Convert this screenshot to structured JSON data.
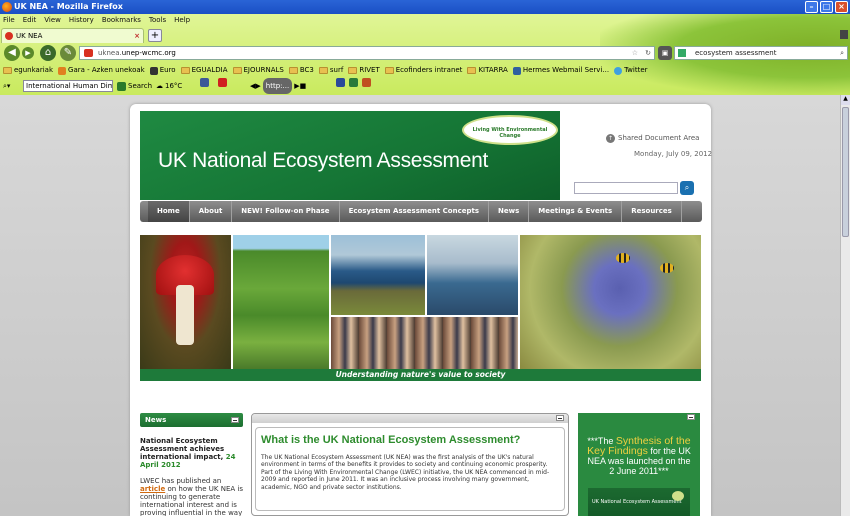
{
  "browser": {
    "window_title": "UK NEA - Mozilla Firefox",
    "menu": [
      "File",
      "Edit",
      "View",
      "History",
      "Bookmarks",
      "Tools",
      "Help"
    ],
    "tab_label": "UK NEA",
    "new_tab": "+",
    "url_prefix": "uknea.",
    "url_domain": "unep-wcmc.org",
    "search_query": "ecosystem assessment",
    "bookmarks": [
      "egunkariak",
      "Gara - Azken unekoak",
      "Euro",
      "EGUALDIA",
      "EJOURNALS",
      "BC3",
      "surf",
      "RIVET",
      "Ecofinders intranet",
      "KITARRA",
      "Hermes Webmail Servi...",
      "Twitter"
    ],
    "toolbar2": {
      "search_input": "International Human Dimensions",
      "search_label": "Search",
      "weather": "16°C",
      "radio_label": "http:..."
    }
  },
  "site": {
    "header_title": "UK National Ecosystem Assessment",
    "lwec_logo_text": "Living With Environmental Change",
    "shared_area": "Shared Document Area",
    "date": "Monday, July 09, 2012",
    "search_button": "⌕",
    "nav": [
      "Home",
      "About",
      "NEW! Follow-on Phase",
      "Ecosystem Assessment Concepts",
      "News",
      "Meetings & Events",
      "Resources"
    ],
    "hero_caption": "Understanding nature's value to society",
    "news": {
      "header": "News",
      "headline": "National Ecosystem Assessment achieves international impact,",
      "headline_date": "24 April 2012",
      "body_before": "LWEC has published an",
      "body_link": "article",
      "body_after": "on how the UK NEA is continuing to generate international interest and is proving influential in the way other nations approach their"
    },
    "main": {
      "title": "What is the UK National Ecosystem Assessment?",
      "text": "The UK National Ecosystem Assessment (UK NEA) was the first analysis of the UK's natural environment in terms of the benefits it provides to society and continuing economic prosperity. Part of the Living With Environmental Change (LWEC) initiative, the UK NEA commenced in mid-2009 and reported in June 2011. It was an inclusive process involving many government, academic, NGO and private sector institutions."
    },
    "synthesis": {
      "prefix": "***The",
      "highlight": "Synthesis of the Key Findings",
      "suffix": "for the UK NEA was launched on the 2 June 2011***",
      "book_label": "UK National Ecosystem Assessment"
    }
  },
  "colors": {
    "brand_green": "#1f8a42",
    "nav_grey": "#6a6a6a",
    "accent_orange": "#d06a10",
    "highlight_yellow": "#f0d040"
  }
}
